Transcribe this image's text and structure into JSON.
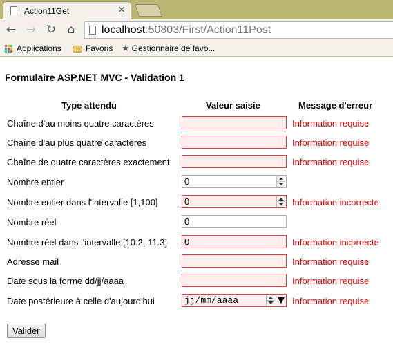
{
  "browser": {
    "tab_title": "Action11Get",
    "close_glyph": "×",
    "url_host": "localhost",
    "url_rest": ":50803/First/Action11Post",
    "bookmarks": {
      "apps": "Applications",
      "favoris": "Favoris",
      "gestionnaire": "Gestionnaire de favo..."
    }
  },
  "form": {
    "title": "Formulaire ASP.NET MVC - Validation 1",
    "headers": {
      "type": "Type attendu",
      "value": "Valeur saisie",
      "error": "Message d'erreur"
    },
    "rows": [
      {
        "label": "Chaîne d'au moins quatre caractères",
        "value": "",
        "error": "Information requise"
      },
      {
        "label": "Chaîne d'au plus quatre caractères",
        "value": "",
        "error": "Information requise"
      },
      {
        "label": "Chaîne de quatre caractères exactement",
        "value": "",
        "error": "Information requise"
      },
      {
        "label": "Nombre entier",
        "value": "0",
        "error": ""
      },
      {
        "label": "Nombre entier dans l'intervalle [1,100]",
        "value": "0",
        "error": "Information incorrecte"
      },
      {
        "label": "Nombre réel",
        "value": "0",
        "error": ""
      },
      {
        "label": "Nombre réel dans l'intervalle [10.2, 11.3]",
        "value": "0",
        "error": "Information incorrecte"
      },
      {
        "label": "Adresse mail",
        "value": "",
        "error": "Information requise"
      },
      {
        "label": "Date sous la forme dd/jj/aaaa",
        "value": "",
        "error": "Information requise"
      },
      {
        "label": "Date postérieure à celle d'aujourd'hui",
        "value": "jj/mm/aaaa",
        "error": "Information requise"
      }
    ],
    "submit_label": "Valider"
  },
  "colors": {
    "error_text": "#e10000",
    "invalid_border": "#e23b3b",
    "invalid_bg": "#ffeeee",
    "tabbar": "#bcb674"
  }
}
